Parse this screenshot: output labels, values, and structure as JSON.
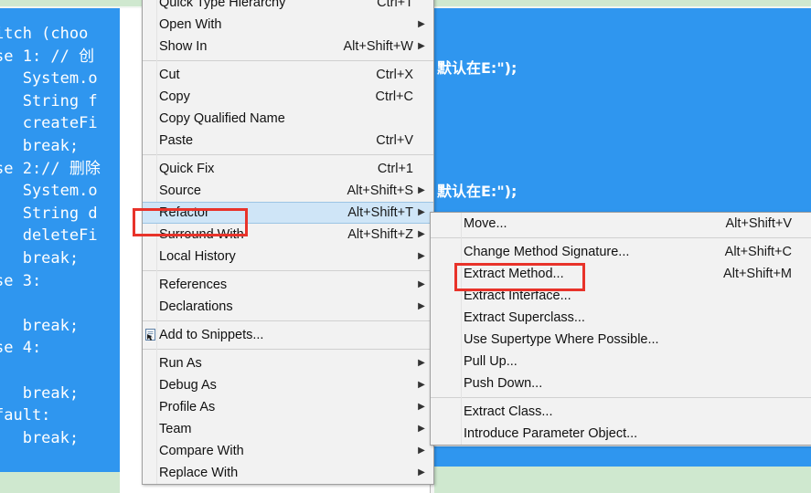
{
  "editor": {
    "left_code": "itch (choo\nse 1: // 创\n   System.o\n   String f\n   createFi\n   break;\nse 2:// 删除\n   System.o\n   String d\n   deleteFi\n   break;\nse 3:\n\n   break;\nse 4:\n\n   break;\nfault:\n   break;",
    "right_code_line_1": "默认在E:\");",
    "right_code_line_2": "默认在E:\");",
    "selection_color": "#2f96ef",
    "selection_text_color": "#ffffff",
    "marker_color": "#cfe8cf",
    "cursor_icon": "text-drag-cursor-icon"
  },
  "context_menu": {
    "name": "editor-context-menu",
    "items": [
      {
        "label": "Quick Type Hierarchy",
        "accel": "Ctrl+T",
        "arrow": false,
        "type": "item"
      },
      {
        "label": "Open With",
        "accel": "",
        "arrow": true,
        "type": "item"
      },
      {
        "label": "Show In",
        "accel": "Alt+Shift+W",
        "arrow": true,
        "type": "item"
      },
      {
        "type": "separator"
      },
      {
        "label": "Cut",
        "accel": "Ctrl+X",
        "arrow": false,
        "type": "item"
      },
      {
        "label": "Copy",
        "accel": "Ctrl+C",
        "arrow": false,
        "type": "item"
      },
      {
        "label": "Copy Qualified Name",
        "accel": "",
        "arrow": false,
        "type": "item"
      },
      {
        "label": "Paste",
        "accel": "Ctrl+V",
        "arrow": false,
        "type": "item"
      },
      {
        "type": "separator"
      },
      {
        "label": "Quick Fix",
        "accel": "Ctrl+1",
        "arrow": false,
        "type": "item"
      },
      {
        "label": "Source",
        "accel": "Alt+Shift+S",
        "arrow": true,
        "type": "item"
      },
      {
        "label": "Refactor",
        "accel": "Alt+Shift+T",
        "arrow": true,
        "type": "item",
        "highlighted": true
      },
      {
        "label": "Surround With",
        "accel": "Alt+Shift+Z",
        "arrow": true,
        "type": "item"
      },
      {
        "label": "Local History",
        "accel": "",
        "arrow": true,
        "type": "item"
      },
      {
        "type": "separator"
      },
      {
        "label": "References",
        "accel": "",
        "arrow": true,
        "type": "item"
      },
      {
        "label": "Declarations",
        "accel": "",
        "arrow": true,
        "type": "item"
      },
      {
        "type": "separator"
      },
      {
        "label": "Add to Snippets...",
        "accel": "",
        "arrow": false,
        "type": "item",
        "icon": "snippet-icon"
      },
      {
        "type": "separator"
      },
      {
        "label": "Run As",
        "accel": "",
        "arrow": true,
        "type": "item"
      },
      {
        "label": "Debug As",
        "accel": "",
        "arrow": true,
        "type": "item"
      },
      {
        "label": "Profile As",
        "accel": "",
        "arrow": true,
        "type": "item"
      },
      {
        "label": "Team",
        "accel": "",
        "arrow": true,
        "type": "item"
      },
      {
        "label": "Compare With",
        "accel": "",
        "arrow": true,
        "type": "item"
      },
      {
        "label": "Replace With",
        "accel": "",
        "arrow": true,
        "type": "item"
      }
    ]
  },
  "submenu": {
    "name": "refactor-submenu",
    "items": [
      {
        "label": "Move...",
        "accel": "Alt+Shift+V",
        "arrow": false,
        "type": "item"
      },
      {
        "type": "separator"
      },
      {
        "label": "Change Method Signature...",
        "accel": "Alt+Shift+C",
        "arrow": false,
        "type": "item"
      },
      {
        "label": "Extract Method...",
        "accel": "Alt+Shift+M",
        "arrow": false,
        "type": "item",
        "annotated": true
      },
      {
        "label": "Extract Interface...",
        "accel": "",
        "arrow": false,
        "type": "item"
      },
      {
        "label": "Extract Superclass...",
        "accel": "",
        "arrow": false,
        "type": "item"
      },
      {
        "label": "Use Supertype Where Possible...",
        "accel": "",
        "arrow": false,
        "type": "item"
      },
      {
        "label": "Pull Up...",
        "accel": "",
        "arrow": false,
        "type": "item"
      },
      {
        "label": "Push Down...",
        "accel": "",
        "arrow": false,
        "type": "item"
      },
      {
        "type": "separator"
      },
      {
        "label": "Extract Class...",
        "accel": "",
        "arrow": false,
        "type": "item"
      },
      {
        "label": "Introduce Parameter Object...",
        "accel": "",
        "arrow": false,
        "type": "item"
      }
    ]
  },
  "annotations": {
    "color": "#e8332a",
    "boxes": [
      {
        "name": "refactor-highlight-box",
        "target": "Refactor"
      },
      {
        "name": "extract-method-highlight-box",
        "target": "Extract Method..."
      }
    ]
  }
}
